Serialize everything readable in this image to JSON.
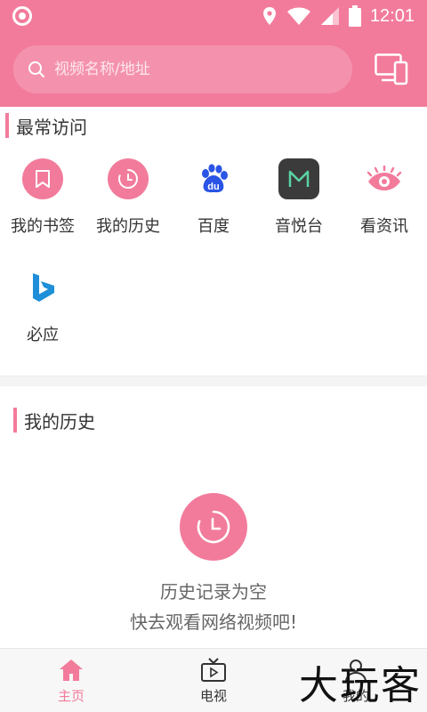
{
  "status_bar": {
    "time": "12:01",
    "icons": [
      "location-icon",
      "wifi-icon",
      "signal-icon",
      "battery-icon"
    ]
  },
  "search": {
    "placeholder": "视频名称/地址"
  },
  "sections": {
    "frequent_title": "最常访问",
    "history_title": "我的历史"
  },
  "shortcuts": [
    {
      "label": "我的书签",
      "icon": "bookmark-icon"
    },
    {
      "label": "我的历史",
      "icon": "history-clock-icon"
    },
    {
      "label": "百度",
      "icon": "baidu-paw-icon"
    },
    {
      "label": "音悦台",
      "icon": "yinyuetai-m-icon"
    },
    {
      "label": "看资讯",
      "icon": "eye-icon"
    },
    {
      "label": "必应",
      "icon": "bing-icon"
    }
  ],
  "history_empty": {
    "line1": "历史记录为空",
    "line2": "快去观看网络视频吧!"
  },
  "bottom_nav": [
    {
      "label": "主页",
      "icon": "home-icon",
      "active": true
    },
    {
      "label": "电视",
      "icon": "tv-icon",
      "active": false
    },
    {
      "label": "我的",
      "icon": "user-icon",
      "active": false
    }
  ],
  "watermark": "大玩客",
  "colors": {
    "brand": "#f27b9b",
    "text": "#333333",
    "muted": "#666666",
    "baidu_blue": "#2a54e6",
    "yinyuetai_green": "#5bd3a5",
    "bing_blue": "#1e8fd8"
  }
}
